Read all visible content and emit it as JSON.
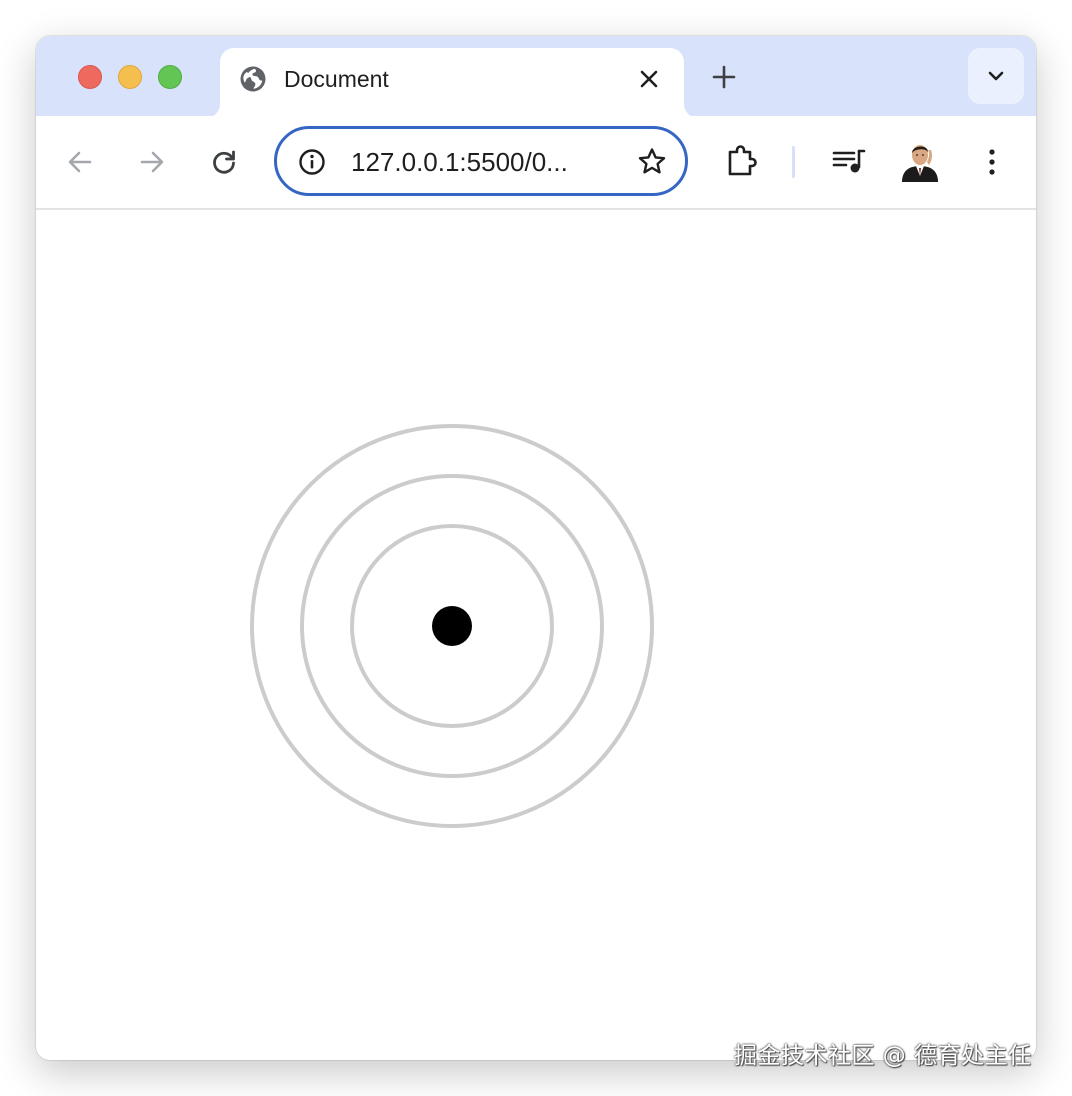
{
  "window": {
    "controls": [
      "close",
      "minimize",
      "zoom"
    ]
  },
  "tab": {
    "title": "Document",
    "favicon": "globe-icon",
    "close_icon": "close-icon"
  },
  "tabstrip": {
    "new_tab_icon": "plus-icon",
    "tab_search_icon": "chevron-down-icon"
  },
  "toolbar": {
    "back_icon": "arrow-left-icon",
    "forward_icon": "arrow-right-icon",
    "reload_icon": "reload-icon",
    "extensions_icon": "puzzle-icon",
    "media_icon": "media-playlist-icon",
    "menu_icon": "kebab-menu-icon"
  },
  "omnibox": {
    "url": "127.0.0.1:5500/0...",
    "info_icon": "info-icon",
    "bookmark_icon": "star-icon"
  },
  "content": {
    "rings": 3,
    "ring_color": "#cccccc",
    "dot_color": "#000000"
  },
  "watermark": {
    "text": "掘金技术社区 @ 德育处主任"
  },
  "colors": {
    "tabstrip_bg": "#d8e2fb",
    "omnibox_border": "#3666c4",
    "traffic_red": "#ee6a5e",
    "traffic_yellow": "#f5bf4f",
    "traffic_green": "#62c554"
  }
}
